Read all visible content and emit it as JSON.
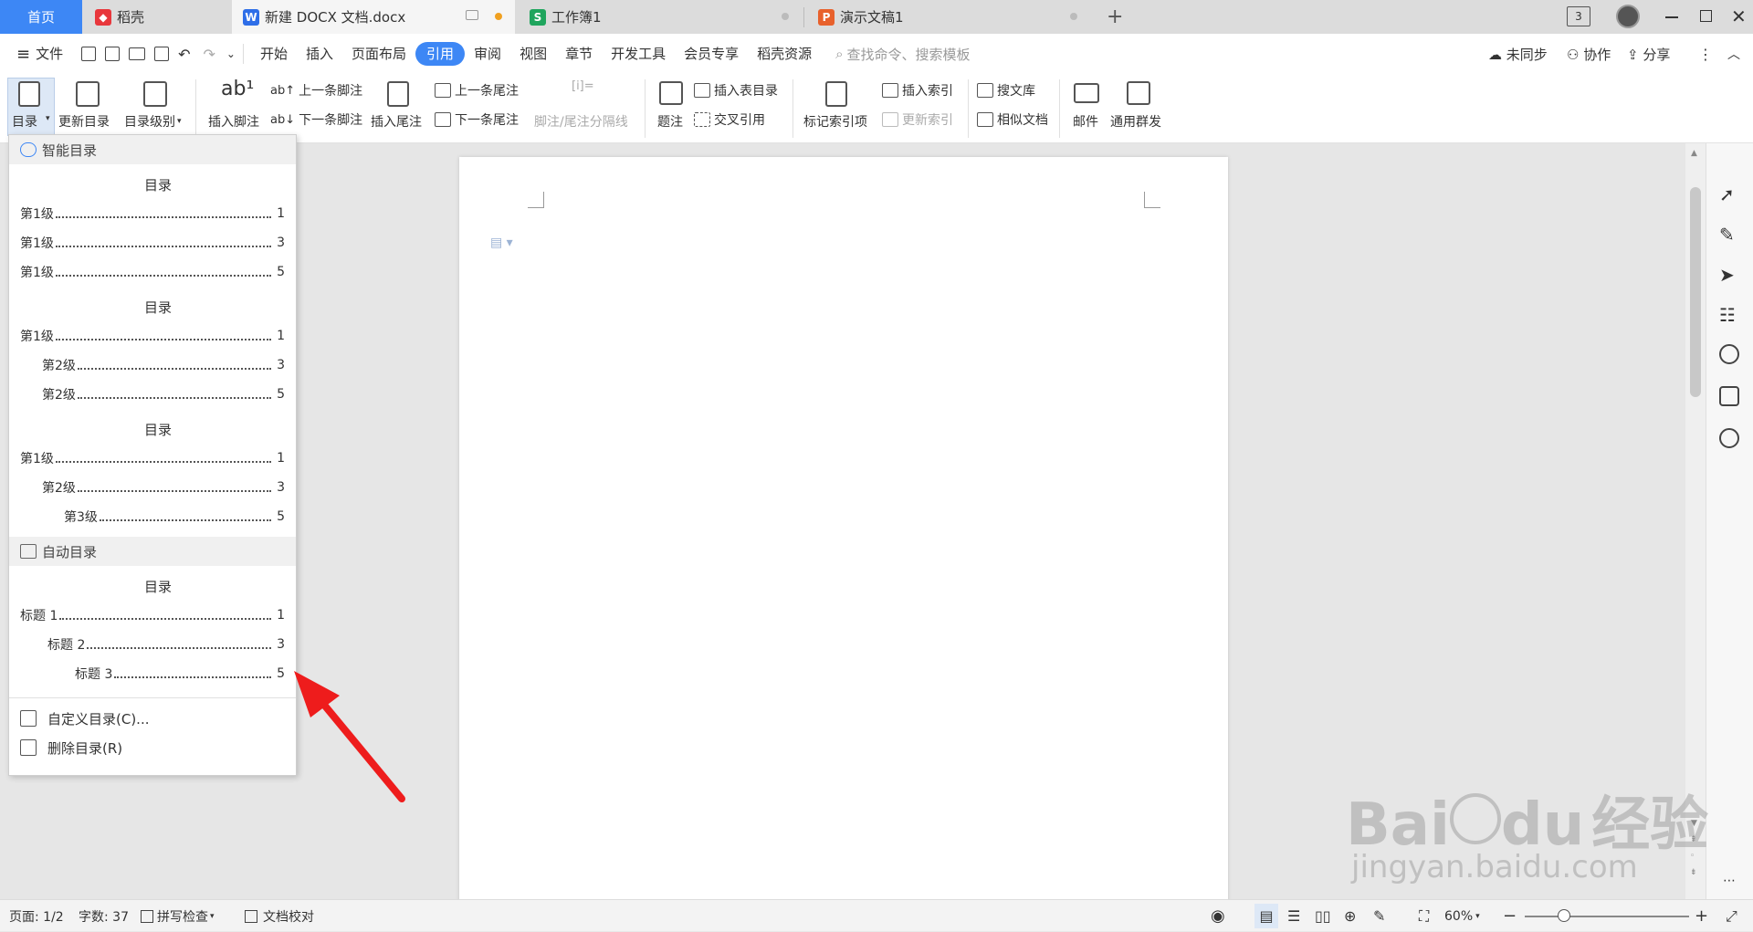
{
  "tabs": {
    "home": "首页",
    "daoke": "稻壳",
    "doc": "新建 DOCX 文档.docx",
    "sheet": "工作簿1",
    "ppt": "演示文稿1",
    "add": "+",
    "win_count": "3"
  },
  "menubar": {
    "file": "文件",
    "items": [
      "开始",
      "插入",
      "页面布局",
      "引用",
      "审阅",
      "视图",
      "章节",
      "开发工具",
      "会员专享",
      "稻壳资源"
    ],
    "active": "引用",
    "search_placeholder": "查找命令、搜索模板",
    "unsynced": "未同步",
    "collab": "协作",
    "share": "分享"
  },
  "ribbon": {
    "toc": "目录",
    "update_toc": "更新目录",
    "toc_level": "目录级别",
    "insert_footnote": "插入脚注",
    "prev_footnote": "上一条脚注",
    "next_footnote": "下一条脚注",
    "insert_endnote": "插入尾注",
    "prev_endnote": "上一条尾注",
    "next_endnote": "下一条尾注",
    "separator": "脚注/尾注分隔线",
    "caption": "题注",
    "insert_table_toc": "插入表目录",
    "cross_ref": "交叉引用",
    "mark_index": "标记索引项",
    "insert_index": "插入索引",
    "update_index": "更新索引",
    "search_lib": "搜文库",
    "similar_doc": "相似文档",
    "mail": "邮件",
    "mass_send": "通用群发"
  },
  "dropdown": {
    "smart_header": "智能目录",
    "toc_title": "目录",
    "block1": [
      {
        "label": "第1级",
        "page": "1",
        "indent": 0
      },
      {
        "label": "第1级",
        "page": "3",
        "indent": 0
      },
      {
        "label": "第1级",
        "page": "5",
        "indent": 0
      }
    ],
    "block2": [
      {
        "label": "第1级",
        "page": "1",
        "indent": 0
      },
      {
        "label": "第2级",
        "page": "3",
        "indent": 1
      },
      {
        "label": "第2级",
        "page": "5",
        "indent": 1
      }
    ],
    "block3": [
      {
        "label": "第1级",
        "page": "1",
        "indent": 0
      },
      {
        "label": "第2级",
        "page": "3",
        "indent": 1
      },
      {
        "label": "第3级",
        "page": "5",
        "indent": 2
      }
    ],
    "auto_header": "自动目录",
    "block4": [
      {
        "label": "标题 1",
        "page": "1",
        "indent": 0
      },
      {
        "label": "标题 2",
        "page": "3",
        "indent": 1
      },
      {
        "label": "标题 3",
        "page": "5",
        "indent": 2
      }
    ],
    "custom": "自定义目录(C)...",
    "delete": "删除目录(R)"
  },
  "status": {
    "page": "页面: 1/2",
    "words": "字数: 37",
    "spell": "拼写检查",
    "proof": "文档校对",
    "zoom": "60%"
  },
  "watermark": {
    "brand": "Bai",
    "brand2": "du",
    "cn": "经验",
    "url": "jingyan.baidu.com"
  },
  "colors": {
    "accent": "#3d87f5",
    "arrow": "#ee1c1c"
  }
}
